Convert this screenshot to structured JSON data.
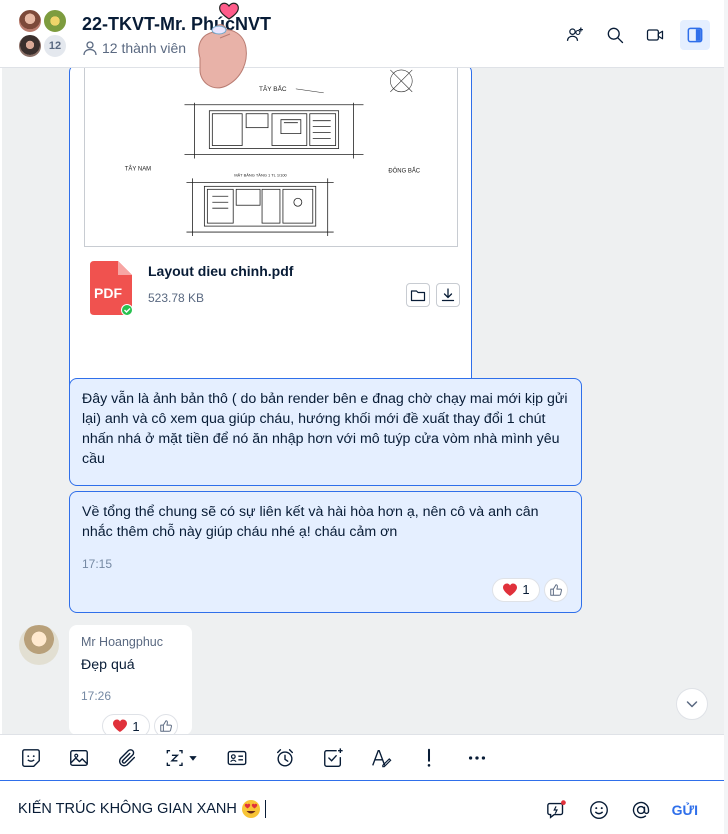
{
  "header": {
    "title": "22-TKVT-Mr. PhúcNVT",
    "member_count_label": "12 thành viên",
    "avatar_extra_count": "12",
    "icons": [
      "add-member-icon",
      "search-icon",
      "video-call-icon",
      "panel-toggle-icon"
    ]
  },
  "file_message": {
    "file_name": "Layout dieu chinh.pdf",
    "file_size": "523.78 KB",
    "file_type_label": "PDF",
    "preview_labels": {
      "top": "TÂY BẮC",
      "left": "TÂY NAM",
      "right": "ĐÔNG BẮC",
      "caption": "MẶT BẰNG TẦNG 1 TL 1/100"
    }
  },
  "messages": [
    {
      "text": "Đây vẫn là ảnh bản thô ( do bản render bên e đnag chờ chạy mai mới kịp gửi lại) anh và cô xem qua giúp cháu, hướng khối mới đề xuất thay đổi 1 chút nhấn nhá ở mặt tiền để nó ăn nhập hơn với mô tuýp cửa vòm nhà mình yêu cầu"
    },
    {
      "text": "Về tổng thể chung sẽ có sự liên kết và hài hòa hơn ạ, nên cô và anh cân nhắc thêm chỗ này giúp cháu nhé ạ! cháu cảm ơn",
      "time": "17:15",
      "reaction_count": "1"
    }
  ],
  "incoming": {
    "sender": "Mr Hoangphuc",
    "text": "Đẹp quá",
    "time": "17:26",
    "reaction_count": "1"
  },
  "composer": {
    "value": "KIẾN TRÚC KHÔNG GIAN XANH",
    "send_label": "GỬI"
  },
  "colors": {
    "accent": "#2f6fea",
    "bubble_self": "#e5efff",
    "chat_bg": "#eef0f1",
    "pdf_red": "#f0524f",
    "heart": "#e0313b"
  }
}
